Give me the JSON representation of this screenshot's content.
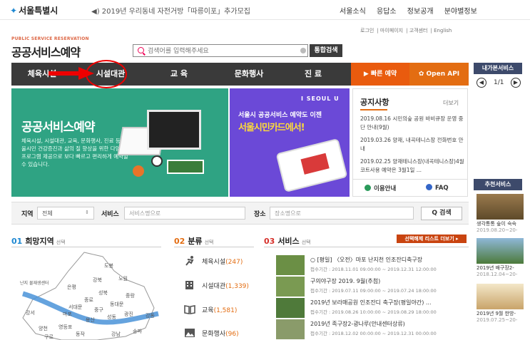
{
  "header": {
    "city_name": "서울특별시",
    "notice": "◀) 2019년 우리동네 자전거방「따릉이포」추가모집",
    "links": [
      "서울소식",
      "응답소",
      "정보공개",
      "분야별정보"
    ]
  },
  "util_links": [
    "로그인",
    "마이페이지",
    "고객센터",
    "English"
  ],
  "brand": {
    "subtitle": "PUBLIC SERVICE RESERVATION",
    "title": "공공서비스예약"
  },
  "search": {
    "placeholder": "검색어를 입력해주세요",
    "button": "통합검색"
  },
  "nav": {
    "items": [
      "체육시설",
      "시설대관",
      "교 육",
      "문화행사",
      "진 료"
    ],
    "quick_reserve": "▶ 빠른 예약",
    "open_api": "✿ Open API"
  },
  "right_rail": {
    "mine_title": "내가본서비스",
    "pager": "1/1",
    "recommend_title": "추천서비스",
    "cards": [
      {
        "title": "생각통통 숲이 숙숙",
        "date": "2019.08.20~20-"
      },
      {
        "title": "2019년 배구장2-",
        "date": "2018.12.04~20-"
      },
      {
        "title": "2019년 9월 한방-",
        "date": "2019.07.25~20-"
      }
    ]
  },
  "banner_main": {
    "title": "공공서비스예약",
    "desc": "체육시설, 시설대관, 교육, 문화행사, 진료 등 서울시민 건강증진과 삶의 질 향상을 위한 다양한 프로그램 제공으로 보다 빠르고 편리하게 예약할 수 있습니다."
  },
  "banner_card": {
    "brand": "I SEOUL U",
    "line1": "서울시 공공서비스 예약도 이젠",
    "line2": "서울시민카드에서!"
  },
  "notice_panel": {
    "title": "공지사항",
    "more": "더보기",
    "items": [
      "2019.08.16 시민의숲 공원 바비큐장 운영 중단 안내(9월)",
      "2019.03.26 양재, 내곡테니스장 전화번호 안내",
      "2019.02.25 양재테니스장(내곡테니스장)4월 코트사용 예약은 3월1일 ..."
    ],
    "guide": "이용안내",
    "faq": "FAQ"
  },
  "filter": {
    "region_label": "지역",
    "region_value": "전체",
    "service_label": "서비스",
    "service_placeholder": "서비스명으로",
    "place_label": "장소",
    "place_placeholder": "장소명으로",
    "search_button": "Q 검색"
  },
  "section1": {
    "num": "01",
    "title": "희망지역",
    "sub": "선택"
  },
  "section2": {
    "num": "02",
    "title": "분류",
    "sub": "선택"
  },
  "section3": {
    "num": "03",
    "title": "서비스",
    "sub": "선택"
  },
  "map_districts": [
    "도봉",
    "강북",
    "노원",
    "은평",
    "성북",
    "중랑",
    "종로",
    "동대문",
    "서대문",
    "중구",
    "광진",
    "강동",
    "마포",
    "용산",
    "성동",
    "강서",
    "양천",
    "영등포",
    "동작",
    "송파",
    "강남",
    "구로",
    "난지 물재생센터"
  ],
  "categories": [
    {
      "name": "체육시설",
      "count": "(247)"
    },
    {
      "name": "시설대관",
      "count": "(1,339)"
    },
    {
      "name": "교육",
      "count": "(1,581)"
    },
    {
      "name": "문화행사",
      "count": "(96)"
    }
  ],
  "services_badge": "선택해제 리스트 더보기 ▸",
  "services": [
    {
      "title": "○ [평일] 〈오전〉마포 난지천 인조잔디축구장",
      "period": "접수기간 : 2018.11.01 09:00:00 ~ 2019.12.31 12:00:00"
    },
    {
      "title": "구의야구장 2019. 9월(추첨)",
      "period": "접수기간 : 2019.07.11 09:00:00 ~ 2019.07.24 18:00:00"
    },
    {
      "title": "2019년 보라매공원 인조잔디 축구장(평일야간) ...",
      "period": "접수기간 : 2019.08.26 10:00:00 ~ 2019.08.29 18:00:00"
    },
    {
      "title": "2019년 족구장2-광나루(안내센터상류)",
      "period": "접수기간 : 2018.12.02 00:00:00 ~ 2019.12.31 00:00:00"
    }
  ]
}
